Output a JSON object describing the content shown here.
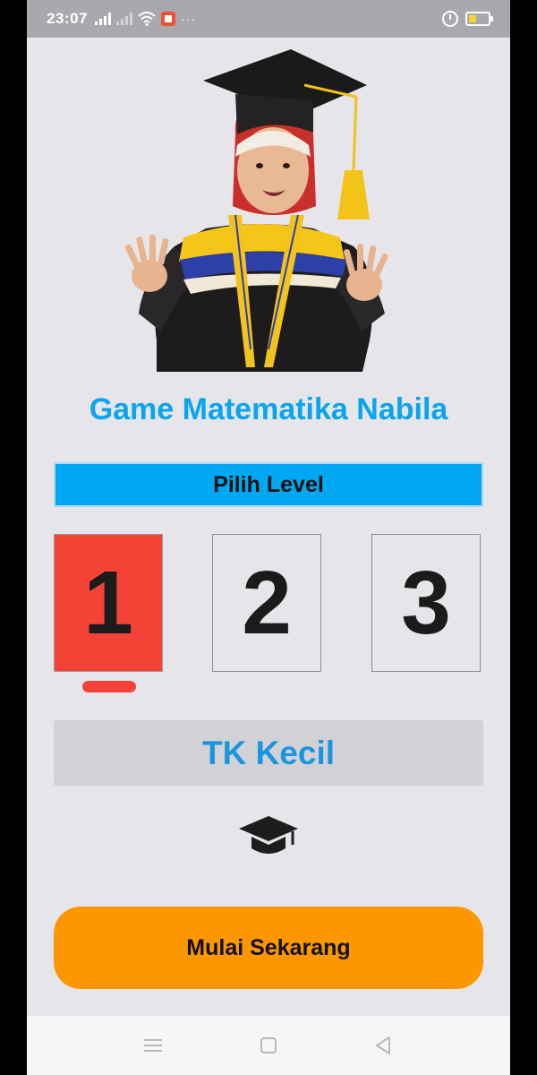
{
  "status_bar": {
    "time": "23:07",
    "more": "···",
    "icons": [
      "signal-icon",
      "signal-disabled-icon",
      "wifi-icon",
      "notification-app-icon",
      "alarm-icon",
      "battery-icon"
    ]
  },
  "app": {
    "title": "Game Matematika Nabila",
    "level_header": "Pilih Level",
    "levels": [
      {
        "label": "1",
        "selected": true
      },
      {
        "label": "2",
        "selected": false
      },
      {
        "label": "3",
        "selected": false
      }
    ],
    "selected_level_name": "TK Kecil",
    "start_button": "Mulai Sekarang"
  },
  "colors": {
    "title": "#0aa4ef",
    "header_bg": "#00a8f3",
    "selected_card": "#f44336",
    "level_name_text": "#1b96de",
    "start_button": "#fd9700",
    "background": "#e6e5ea"
  },
  "nav_bar": {
    "icons": [
      "menu-icon",
      "home-icon",
      "back-icon"
    ]
  }
}
